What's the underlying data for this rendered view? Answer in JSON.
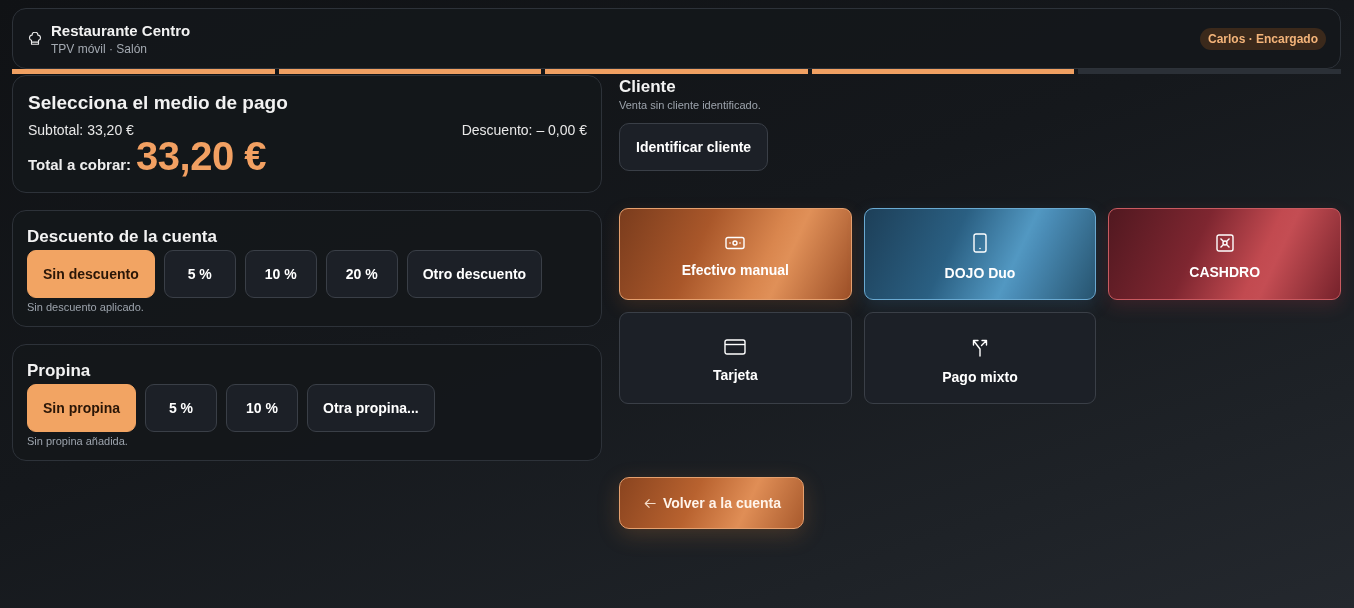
{
  "header": {
    "title": "Restaurante Centro",
    "subtitle": "TPV móvil · Salón",
    "user_badge": "Carlos · Encargado"
  },
  "steps": [
    {
      "complete": true
    },
    {
      "complete": true
    },
    {
      "complete": true
    },
    {
      "complete": true
    },
    {
      "complete": false
    }
  ],
  "summary": {
    "title": "Selecciona el medio de pago",
    "subtotal": "Subtotal: 33,20 €",
    "discount": "Descuento: – 0,00 €",
    "total_label": "Total a cobrar:",
    "total": "33,20 €"
  },
  "discount": {
    "title": "Descuento de la cuenta",
    "options": [
      {
        "label": "Sin descuento",
        "selected": true
      },
      {
        "label": "5 %",
        "selected": false
      },
      {
        "label": "10 %",
        "selected": false
      },
      {
        "label": "20 %",
        "selected": false
      },
      {
        "label": "Otro descuento",
        "selected": false
      }
    ],
    "hint": "Sin descuento aplicado."
  },
  "tip": {
    "title": "Propina",
    "options": [
      {
        "label": "Sin propina",
        "selected": true
      },
      {
        "label": "5 %",
        "selected": false
      },
      {
        "label": "10 %",
        "selected": false
      },
      {
        "label": "Otra propina...",
        "selected": false
      }
    ],
    "hint": "Sin propina añadida."
  },
  "client": {
    "title": "Cliente",
    "hint": "Venta sin cliente identificado.",
    "button": "Identificar cliente"
  },
  "payment_methods": [
    {
      "label": "Efectivo manual",
      "kind": "cash"
    },
    {
      "label": "DOJO Duo",
      "kind": "terminal"
    },
    {
      "label": "CASHDRO",
      "kind": "cashdro"
    },
    {
      "label": "Tarjeta",
      "kind": "card"
    },
    {
      "label": "Pago mixto",
      "kind": "mixed"
    }
  ],
  "back_button": {
    "label": "Volver a la cuenta"
  }
}
